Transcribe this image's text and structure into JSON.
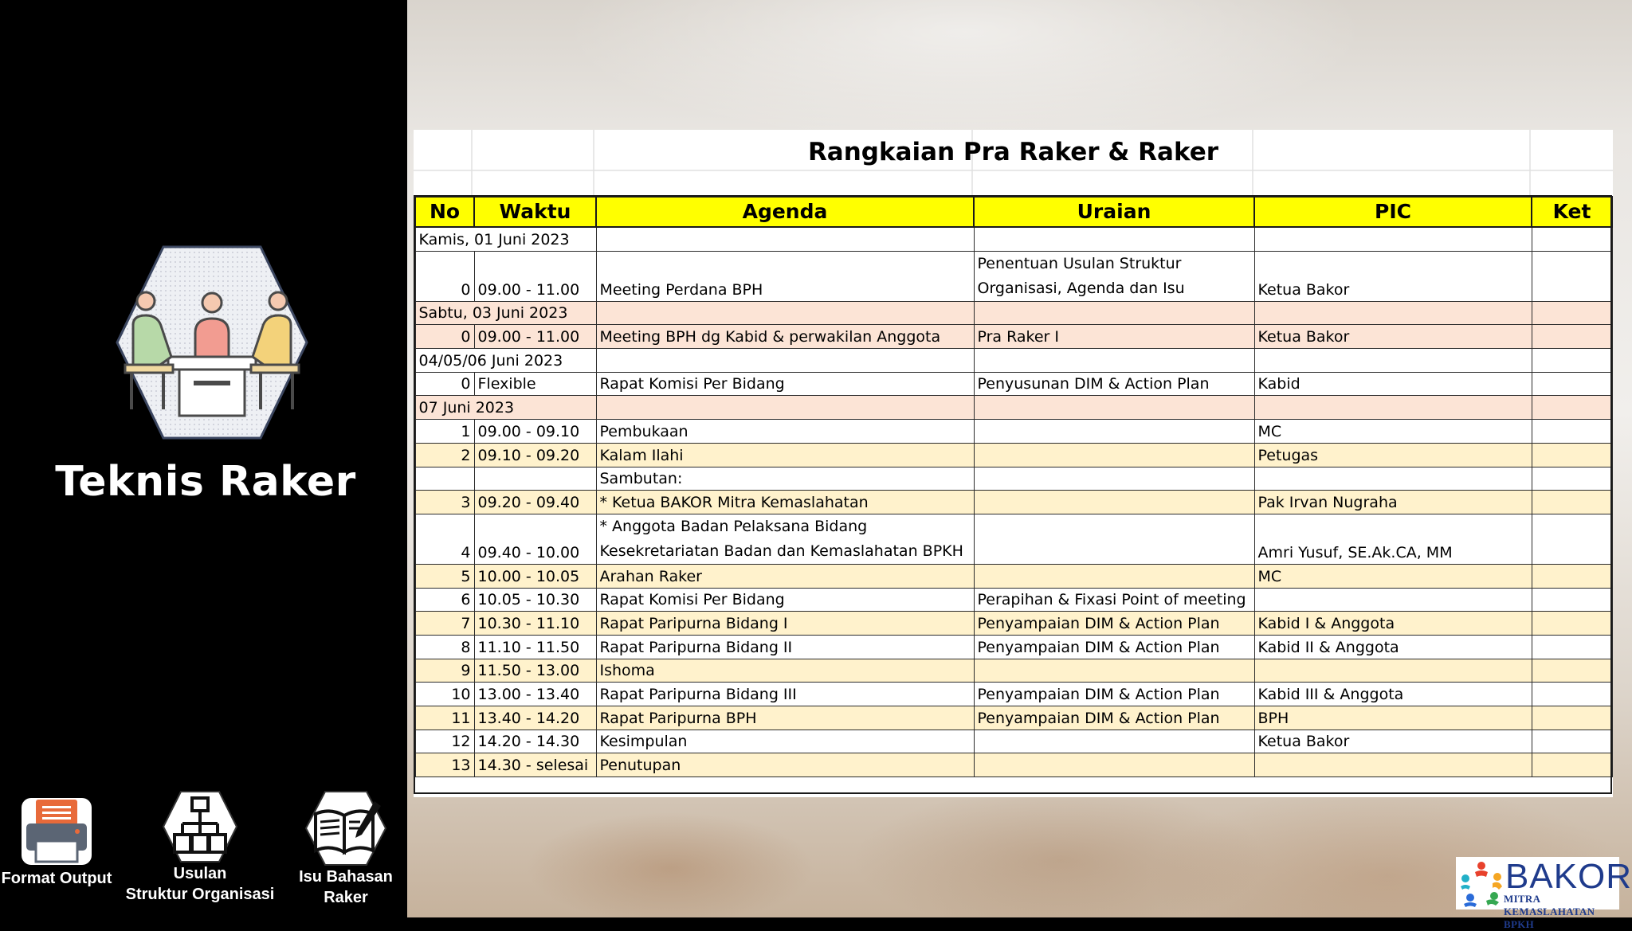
{
  "sidebar": {
    "title": "Teknis Raker",
    "nav": [
      {
        "label": "Format Output",
        "icon": "printer-icon"
      },
      {
        "label": "Usulan\nStruktur Organisasi",
        "icon": "org-chart-icon"
      },
      {
        "label": "Isu Bahasan\nRaker",
        "icon": "notebook-pen-icon"
      }
    ],
    "main_icon": "meeting-people-icon"
  },
  "sheet": {
    "title": "Rangkaian Pra Raker & Raker",
    "headers": [
      "No",
      "Waktu",
      "Agenda",
      "Uraian",
      "PIC",
      "Ket"
    ],
    "rows": [
      {
        "style": "white",
        "date": "Kamis, 01 Juni 2023"
      },
      {
        "style": "white",
        "tall": true,
        "no": "0",
        "waktu": "09.00 - 11.00",
        "agenda": "Meeting Perdana BPH",
        "uraian_1": "Penentuan Usulan Struktur",
        "uraian_2": "Organisasi, Agenda dan Isu",
        "pic": "Ketua Bakor",
        "ket": ""
      },
      {
        "style": "pink",
        "date": "Sabtu, 03 Juni 2023"
      },
      {
        "style": "pink",
        "no": "0",
        "waktu": "09.00 - 11.00",
        "agenda": "Meeting BPH dg Kabid & perwakilan Anggota",
        "uraian": "Pra Raker I",
        "pic": "Ketua Bakor",
        "ket": ""
      },
      {
        "style": "white",
        "date": "04/05/06 Juni 2023"
      },
      {
        "style": "white",
        "no": "0",
        "waktu": "Flexible",
        "agenda": "Rapat Komisi Per Bidang",
        "uraian": "Penyusunan DIM & Action Plan",
        "pic": "Kabid",
        "ket": ""
      },
      {
        "style": "pink",
        "date": "07 Juni 2023"
      },
      {
        "style": "white",
        "no": "1",
        "waktu": "09.00 - 09.10",
        "agenda": "Pembukaan",
        "uraian": "",
        "pic": "MC",
        "ket": ""
      },
      {
        "style": "peach",
        "no": "2",
        "waktu": "09.10 - 09.20",
        "agenda": "Kalam Ilahi",
        "uraian": "",
        "pic": "Petugas",
        "ket": ""
      },
      {
        "style": "white",
        "no": "",
        "waktu": "",
        "agenda": "Sambutan:",
        "uraian": "",
        "pic": "",
        "ket": ""
      },
      {
        "style": "peach",
        "no": "3",
        "waktu": "09.20 - 09.40",
        "agenda": "* Ketua BAKOR Mitra Kemaslahatan",
        "uraian": "",
        "pic": "Pak Irvan Nugraha",
        "ket": ""
      },
      {
        "style": "white",
        "tall": true,
        "no": "4",
        "waktu": "09.40 - 10.00",
        "agenda_1": "* Anggota Badan Pelaksana Bidang",
        "agenda_2": "Kesekretariatan Badan dan Kemaslahatan BPKH",
        "uraian": "",
        "pic": "Amri Yusuf, SE.Ak.CA, MM",
        "ket": ""
      },
      {
        "style": "peach",
        "no": "5",
        "waktu": "10.00 - 10.05",
        "agenda": "Arahan Raker",
        "uraian": "",
        "pic": "MC",
        "ket": ""
      },
      {
        "style": "white",
        "no": "6",
        "waktu": "10.05 - 10.30",
        "agenda": "Rapat Komisi Per Bidang",
        "uraian": "Perapihan & Fixasi Point of meeting",
        "pic": "",
        "ket": ""
      },
      {
        "style": "peach",
        "no": "7",
        "waktu": "10.30 - 11.10",
        "agenda": "Rapat Paripurna Bidang I",
        "uraian": "Penyampaian DIM & Action Plan",
        "pic": "Kabid I & Anggota",
        "ket": ""
      },
      {
        "style": "white",
        "no": "8",
        "waktu": "11.10 - 11.50",
        "agenda": "Rapat Paripurna Bidang II",
        "uraian": "Penyampaian DIM & Action Plan",
        "pic": "Kabid II & Anggota",
        "ket": ""
      },
      {
        "style": "peach",
        "no": "9",
        "waktu": "11.50 - 13.00",
        "agenda": "Ishoma",
        "uraian": "",
        "pic": "",
        "ket": ""
      },
      {
        "style": "white",
        "no": "10",
        "waktu": "13.00 - 13.40",
        "agenda": "Rapat Paripurna Bidang III",
        "uraian": "Penyampaian DIM & Action Plan",
        "pic": "Kabid III & Anggota",
        "ket": ""
      },
      {
        "style": "peach",
        "no": "11",
        "waktu": "13.40 - 14.20",
        "agenda": "Rapat Paripurna BPH",
        "uraian": "Penyampaian DIM & Action Plan",
        "pic": "BPH",
        "ket": ""
      },
      {
        "style": "white",
        "no": "12",
        "waktu": "14.20 - 14.30",
        "agenda": "Kesimpulan",
        "uraian": "",
        "pic": "Ketua Bakor",
        "ket": ""
      },
      {
        "style": "peach",
        "no": "13",
        "waktu": "14.30 - selesai",
        "agenda": "Penutupan",
        "uraian": "",
        "pic": "",
        "ket": ""
      }
    ]
  },
  "logo": {
    "name": "BAKOR",
    "subtitle": "MITRA KEMASLAHATAN BPKH"
  },
  "colors": {
    "header_yellow": "#ffff00",
    "row_pink": "#fce4d6",
    "row_peach": "#fff2cc",
    "logo_blue": "#1f3b8c"
  }
}
